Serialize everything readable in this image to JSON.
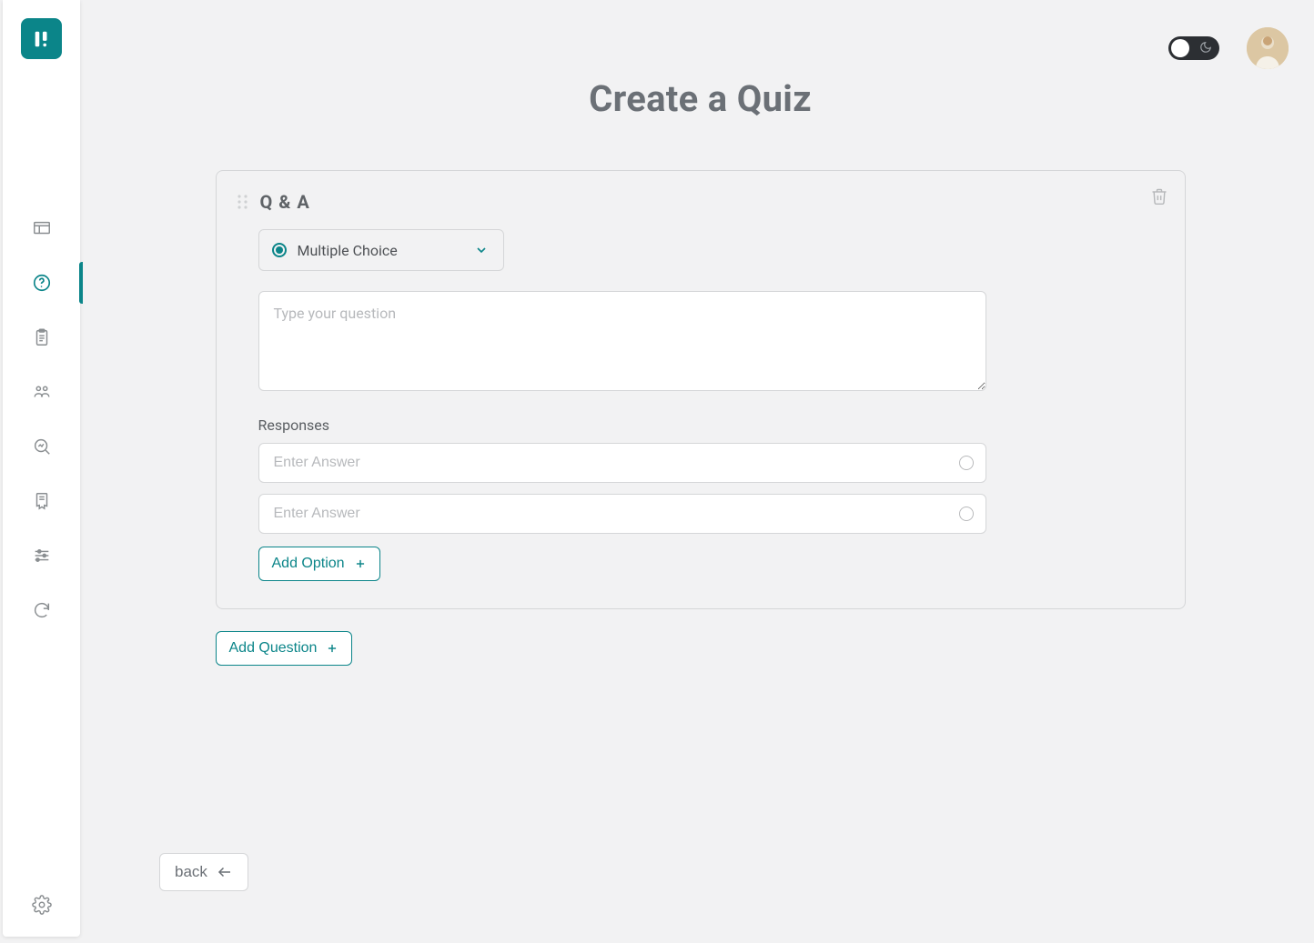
{
  "page": {
    "title": "Create a Quiz"
  },
  "sidebar": {
    "items": [
      {
        "icon": "board-icon"
      },
      {
        "icon": "question-icon",
        "active": true
      },
      {
        "icon": "clipboard-icon"
      },
      {
        "icon": "group-icon"
      },
      {
        "icon": "analytics-icon"
      },
      {
        "icon": "cert-icon"
      },
      {
        "icon": "filters-icon"
      },
      {
        "icon": "sync-icon"
      }
    ],
    "bottom_icon": "settings-icon"
  },
  "topbar": {
    "theme": "light"
  },
  "card": {
    "title": "Q & A",
    "type_select": {
      "selected": "Multiple Choice"
    },
    "question": {
      "placeholder": "Type your question",
      "value": ""
    },
    "responses_label": "Responses",
    "answers": [
      {
        "placeholder": "Enter Answer",
        "value": "",
        "correct": false
      },
      {
        "placeholder": "Enter Answer",
        "value": "",
        "correct": false
      }
    ],
    "add_option_label": "Add Option"
  },
  "add_question_label": "Add Question",
  "back_label": "back"
}
